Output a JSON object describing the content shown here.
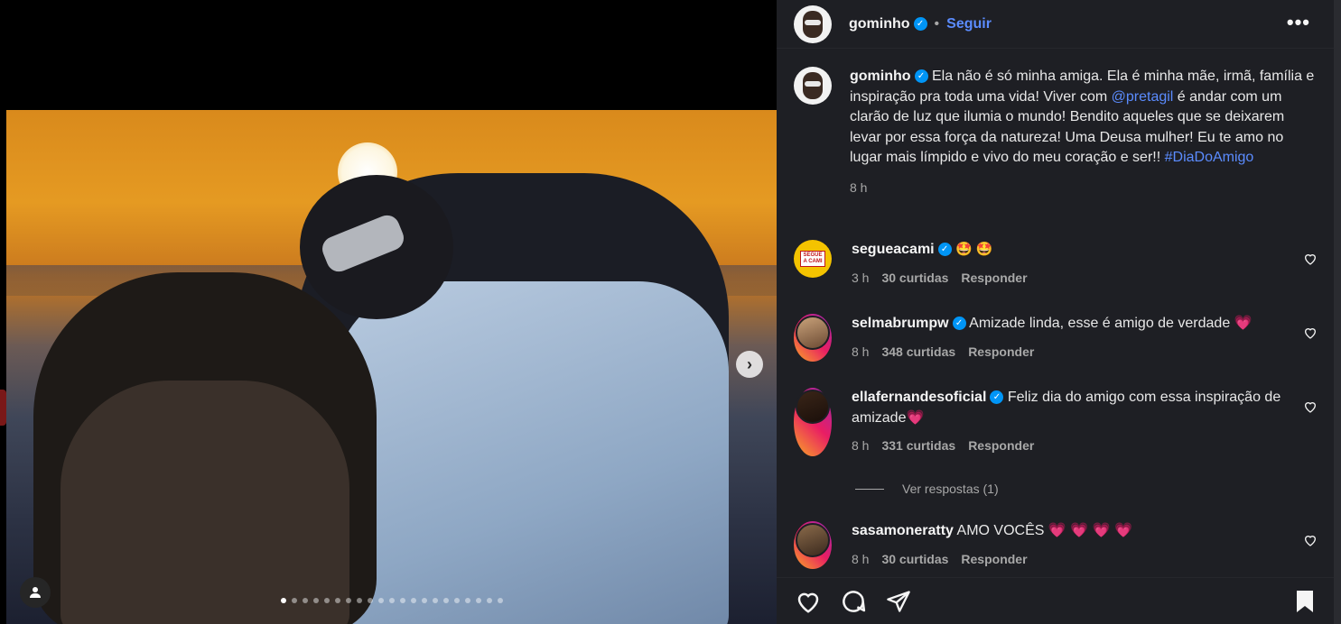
{
  "post": {
    "username": "gominho",
    "follow_label": "Seguir",
    "separator": "•",
    "more_label": "•••",
    "caption_text": "Ela não é só minha amiga. Ela é minha mãe, irmã, família e inspiração pra toda uma vida! Viver com ",
    "caption_mention": "@pretagil",
    "caption_text2": " é andar com um clarão de luz que ilumia o mundo! Bendito aqueles que se deixarem levar por essa força da natureza! Uma Deusa mulher! Eu te amo no lugar mais límpido e vivo do meu coração e ser!! ",
    "caption_hashtag": "#DiaDoAmigo",
    "caption_time": "8 h",
    "carousel_total": 21,
    "carousel_active": 1
  },
  "comments": [
    {
      "username": "segueacami",
      "text": "🤩 🤩",
      "time": "3 h",
      "likes": "30 curtidas",
      "reply": "Responder"
    },
    {
      "username": "selmabrumpw",
      "text": "Amizade linda, esse é amigo de verdade 💗",
      "time": "8 h",
      "likes": "348 curtidas",
      "reply": "Responder"
    },
    {
      "username": "ellafernandesoficial",
      "text": "Feliz dia do amigo com essa inspiração de amizade💗",
      "time": "8 h",
      "likes": "331 curtidas",
      "reply": "Responder",
      "view_replies": "Ver respostas (1)"
    },
    {
      "username": "sasamoneratty",
      "text": "AMO VOCÊS 💗 💗 💗 💗",
      "time": "8 h",
      "likes": "30 curtidas",
      "reply": "Responder"
    }
  ],
  "avatar_badge_text": "SEGUE A CAMI",
  "icons": [
    "heart-icon",
    "comment-icon",
    "share-icon",
    "bookmark-icon",
    "chevron-right-icon",
    "user-tag-icon",
    "verified-icon",
    "more-icon"
  ],
  "colors": {
    "link": "#5b8cff",
    "verified": "#0095f6",
    "panel": "#1e1f24"
  }
}
